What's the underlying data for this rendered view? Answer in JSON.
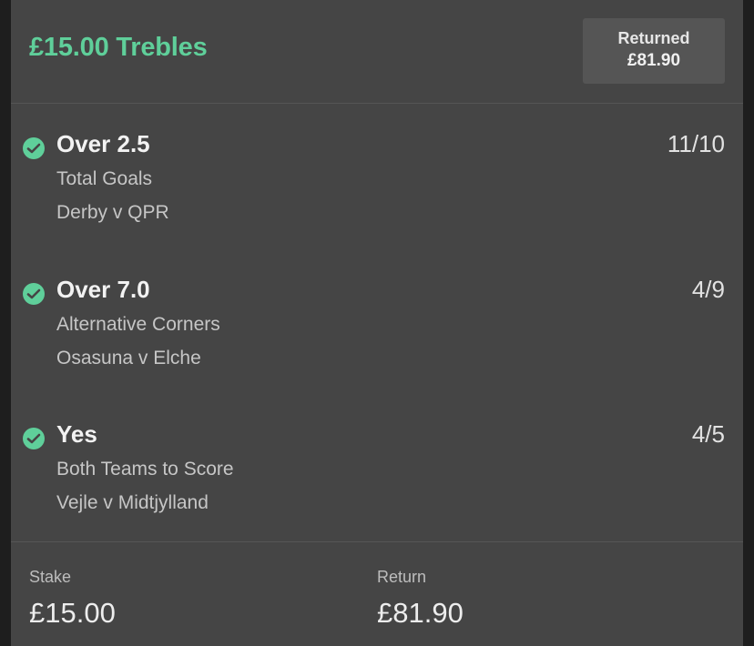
{
  "bet": {
    "title": "£15.00 Trebles",
    "returned_label": "Returned",
    "returned_value": "£81.90"
  },
  "selections": [
    {
      "name": "Over 2.5",
      "market": "Total Goals",
      "event": "Derby v QPR",
      "odds": "11/10",
      "status": "won"
    },
    {
      "name": "Over 7.0",
      "market": "Alternative Corners",
      "event": "Osasuna v Elche",
      "odds": "4/9",
      "status": "won"
    },
    {
      "name": "Yes",
      "market": "Both Teams to Score",
      "event": "Vejle v Midtjylland",
      "odds": "4/5",
      "status": "won"
    }
  ],
  "footer": {
    "stake_label": "Stake",
    "stake_value": "£15.00",
    "return_label": "Return",
    "return_value": "£81.90"
  },
  "colors": {
    "accent": "#5fcf9a",
    "card_background": "#454545",
    "returned_box": "#555555"
  },
  "icons": {
    "selection_status": "check-circle-icon"
  }
}
